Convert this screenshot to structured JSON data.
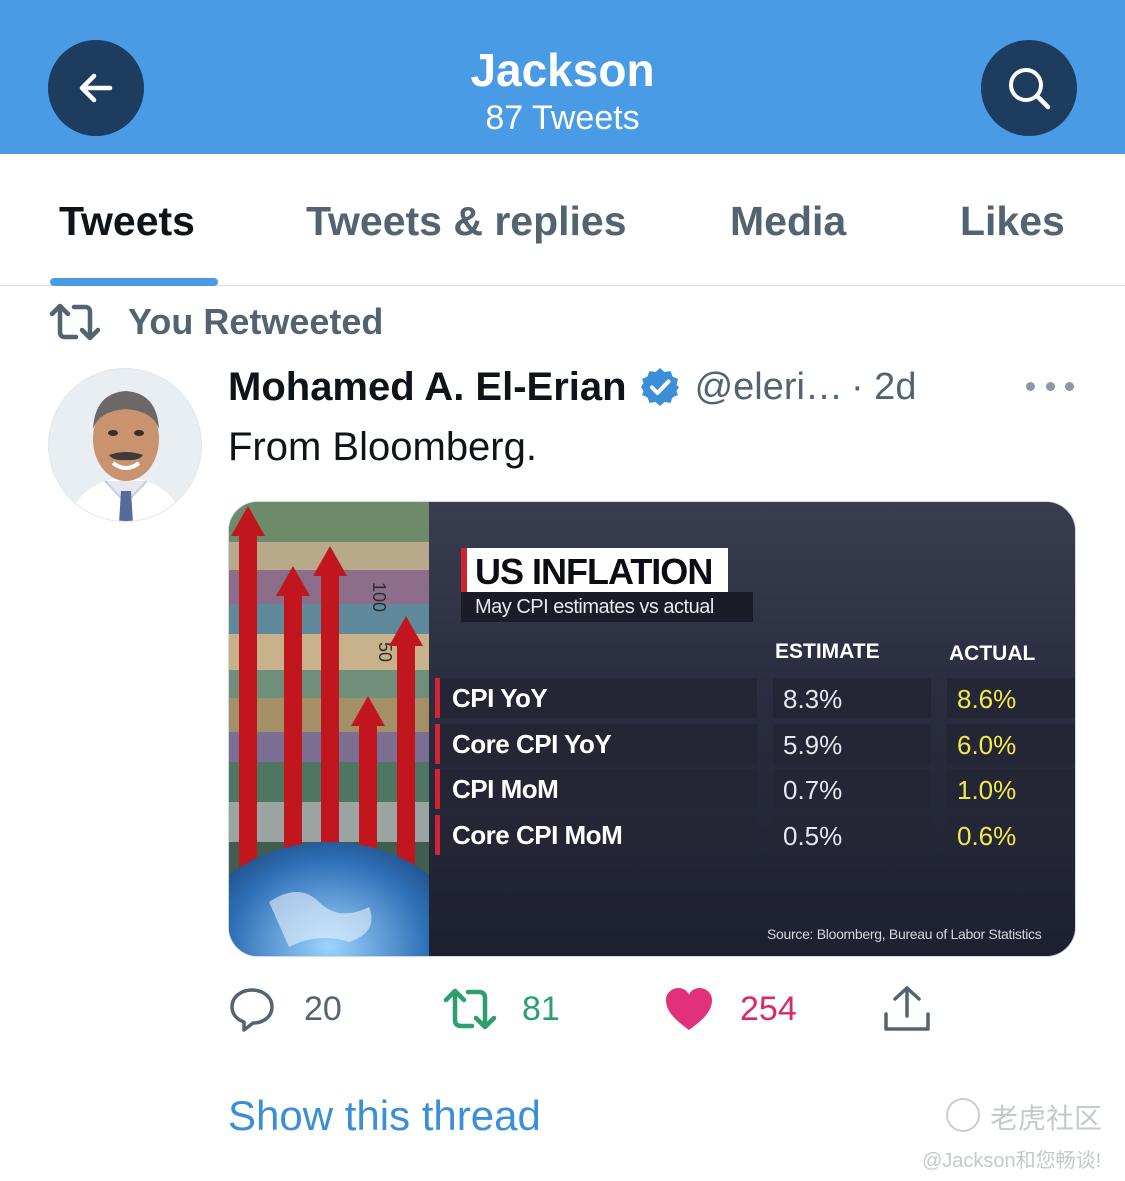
{
  "header": {
    "title": "Jackson",
    "subtitle": "87 Tweets",
    "back_icon": "arrow-left-icon",
    "search_icon": "search-icon",
    "bg_color": "#4a9be6"
  },
  "tabs": [
    {
      "label": "Tweets",
      "active": true
    },
    {
      "label": "Tweets & replies",
      "active": false
    },
    {
      "label": "Media",
      "active": false
    },
    {
      "label": "Likes",
      "active": false
    }
  ],
  "retweet_context": {
    "icon": "retweet-icon",
    "text": "You Retweeted"
  },
  "tweet": {
    "author_name": "Mohamed A. El-Erian",
    "verified": true,
    "handle": "@eleri…",
    "time": "· 2d",
    "text": "From Bloomberg.",
    "media": {
      "title": "US INFLATION",
      "subtitle": "May CPI estimates vs actual",
      "col_estimate": "ESTIMATE",
      "col_actual": "ACTUAL",
      "rows": [
        {
          "label": "CPI YoY",
          "estimate": "8.3%",
          "actual": "8.6%"
        },
        {
          "label": "Core CPI YoY",
          "estimate": "5.9%",
          "actual": "6.0%"
        },
        {
          "label": "CPI MoM",
          "estimate": "0.7%",
          "actual": "1.0%"
        },
        {
          "label": "Core CPI MoM",
          "estimate": "0.5%",
          "actual": "0.6%"
        }
      ],
      "source": "Source: Bloomberg, Bureau of Labor Statistics",
      "banknote_text_1": "100",
      "banknote_text_2": "50"
    },
    "actions": {
      "reply_count": "20",
      "retweet_count": "81",
      "like_count": "254",
      "retweet_color": "#2f9e6e",
      "like_color": "#d9296a"
    },
    "show_thread": "Show this thread"
  },
  "watermark": {
    "brand": "老虎社区",
    "user": "@Jackson和您畅谈!"
  }
}
